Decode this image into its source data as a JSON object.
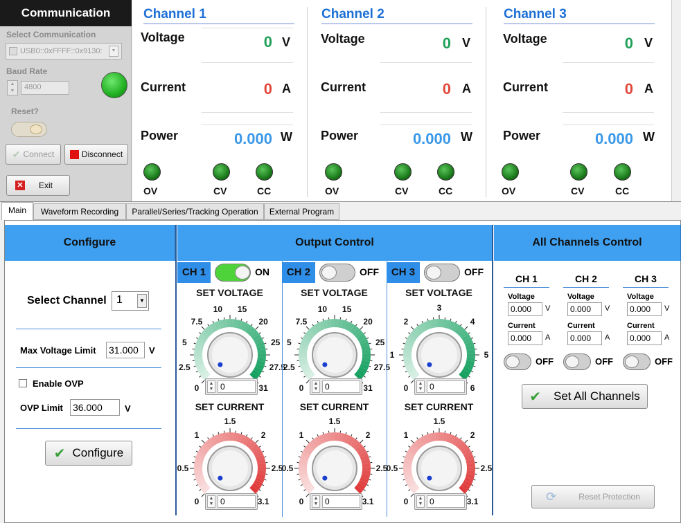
{
  "comm": {
    "title": "Communication",
    "select_label": "Select Communication",
    "select_value": "USB0::0xFFFF::0x9130:",
    "baud_label": "Baud Rate",
    "baud_value": "4800",
    "reset_label": "Reset?",
    "connect_label": "Connect",
    "disconnect_label": "Disconnect",
    "exit_label": "Exit"
  },
  "channels": [
    {
      "title": "Channel 1",
      "voltage_label": "Voltage",
      "voltage": "0",
      "voltage_unit": "V",
      "current_label": "Current",
      "current": "0",
      "current_unit": "A",
      "power_label": "Power",
      "power": "0.000",
      "power_unit": "W",
      "ov": "OV",
      "cv": "CV",
      "cc": "CC"
    },
    {
      "title": "Channel 2",
      "voltage_label": "Voltage",
      "voltage": "0",
      "voltage_unit": "V",
      "current_label": "Current",
      "current": "0",
      "current_unit": "A",
      "power_label": "Power",
      "power": "0.000",
      "power_unit": "W",
      "ov": "OV",
      "cv": "CV",
      "cc": "CC"
    },
    {
      "title": "Channel 3",
      "voltage_label": "Voltage",
      "voltage": "0",
      "voltage_unit": "V",
      "current_label": "Current",
      "current": "0",
      "current_unit": "A",
      "power_label": "Power",
      "power": "0.000",
      "power_unit": "W",
      "ov": "OV",
      "cv": "CV",
      "cc": "CC"
    }
  ],
  "colors": {
    "voltage": "#1fa05a",
    "current": "#e2473b",
    "power": "#3a98e8",
    "accent_head": "#3fa0f2"
  },
  "tabs": [
    "Main",
    "Waveform Recording",
    "Parallel/Series/Tracking Operation",
    "External Program"
  ],
  "configure": {
    "head": "Configure",
    "select_channel_label": "Select Channel",
    "select_channel_value": "1",
    "max_voltage_label": "Max Voltage Limit",
    "max_voltage_value": "31.000",
    "max_voltage_unit": "V",
    "enable_ovp_label": "Enable OVP",
    "ovp_limit_label": "OVP Limit",
    "ovp_limit_value": "36.000",
    "ovp_limit_unit": "V",
    "configure_button": "Configure"
  },
  "output": {
    "head": "Output Control",
    "channels": [
      {
        "badge": "CH 1",
        "state": "ON",
        "set_voltage": "SET VOLTAGE",
        "v_ticks": [
          "0",
          "2.5",
          "5",
          "7.5",
          "10",
          "15",
          "20",
          "25",
          "27.5",
          "31"
        ],
        "v_value": "0",
        "set_current": "SET CURRENT",
        "c_ticks": [
          "0",
          "0.5",
          "1",
          "1.5",
          "2",
          "2.5",
          "3.1"
        ],
        "c_value": "0"
      },
      {
        "badge": "CH 2",
        "state": "OFF",
        "set_voltage": "SET VOLTAGE",
        "v_ticks": [
          "0",
          "2.5",
          "5",
          "7.5",
          "10",
          "15",
          "20",
          "25",
          "27.5",
          "31"
        ],
        "v_value": "0",
        "set_current": "SET CURRENT",
        "c_ticks": [
          "0",
          "0.5",
          "1",
          "1.5",
          "2",
          "2.5",
          "3.1"
        ],
        "c_value": "0"
      },
      {
        "badge": "CH 3",
        "state": "OFF",
        "set_voltage": "SET VOLTAGE",
        "v_ticks": [
          "0",
          "1",
          "2",
          "3",
          "4",
          "5",
          "6"
        ],
        "v_value": "0",
        "set_current": "SET CURRENT",
        "c_ticks": [
          "0",
          "0.5",
          "1",
          "1.5",
          "2",
          "2.5",
          "3.1"
        ],
        "c_value": "0"
      }
    ]
  },
  "all": {
    "head": "All Channels Control",
    "channels": [
      {
        "name": "CH 1",
        "voltage_label": "Voltage",
        "voltage": "0.000",
        "v_unit": "V",
        "current_label": "Current",
        "current": "0.000",
        "a_unit": "A",
        "state": "OFF"
      },
      {
        "name": "CH 2",
        "voltage_label": "Voltage",
        "voltage": "0.000",
        "v_unit": "V",
        "current_label": "Current",
        "current": "0.000",
        "a_unit": "A",
        "state": "OFF"
      },
      {
        "name": "CH 3",
        "voltage_label": "Voltage",
        "voltage": "0.000",
        "v_unit": "V",
        "current_label": "Current",
        "current": "0.000",
        "a_unit": "A",
        "state": "OFF"
      }
    ],
    "set_all_button": "Set All Channels",
    "reset_protection_button": "Reset Protection"
  }
}
